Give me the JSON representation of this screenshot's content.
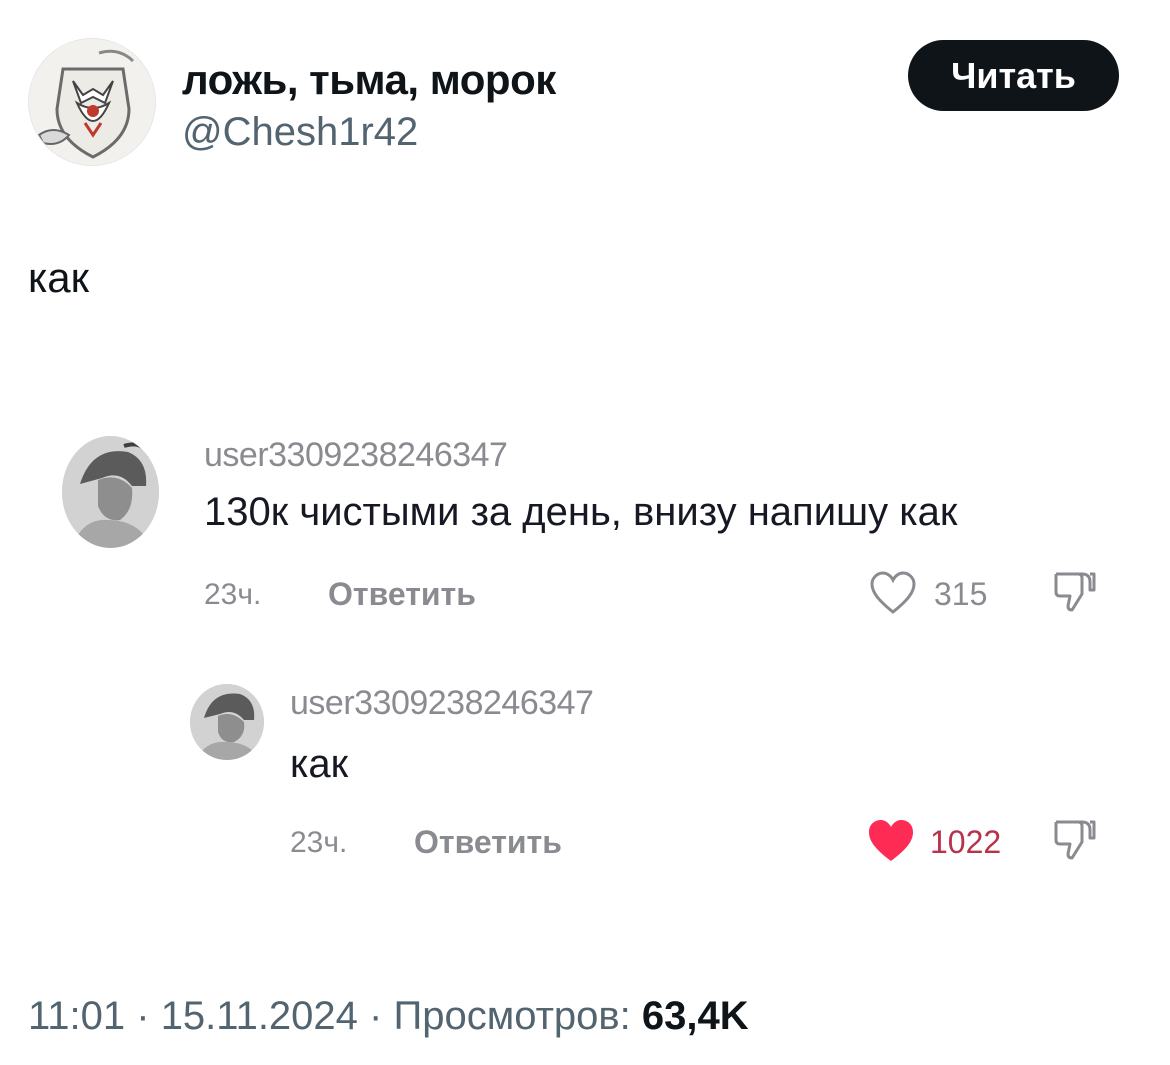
{
  "tweet": {
    "display_name": "ложь, тьма, морок",
    "handle": "@Chesh1r42",
    "follow_label": "Читать",
    "text": "как"
  },
  "comments": [
    {
      "username": "user3309238246347",
      "text": "130к чистыми за день, внизу напишу как",
      "time": "23ч.",
      "reply_label": "Ответить",
      "likes": "315",
      "liked": false
    },
    {
      "username": "user3309238246347",
      "text": "как",
      "time": "23ч.",
      "reply_label": "Ответить",
      "likes": "1022",
      "liked": true
    }
  ],
  "footer": {
    "time": "11:01",
    "separator": " · ",
    "date": "15.11.2024",
    "views_label": "Просмотров:",
    "views_count": "63,4K"
  },
  "colors": {
    "heart_liked": "#fe2c55",
    "button_bg": "#0f1419",
    "secondary_text": "#536471"
  },
  "icons": [
    "profile-avatar",
    "heart-outline-icon",
    "heart-filled-icon",
    "thumbs-down-icon"
  ]
}
